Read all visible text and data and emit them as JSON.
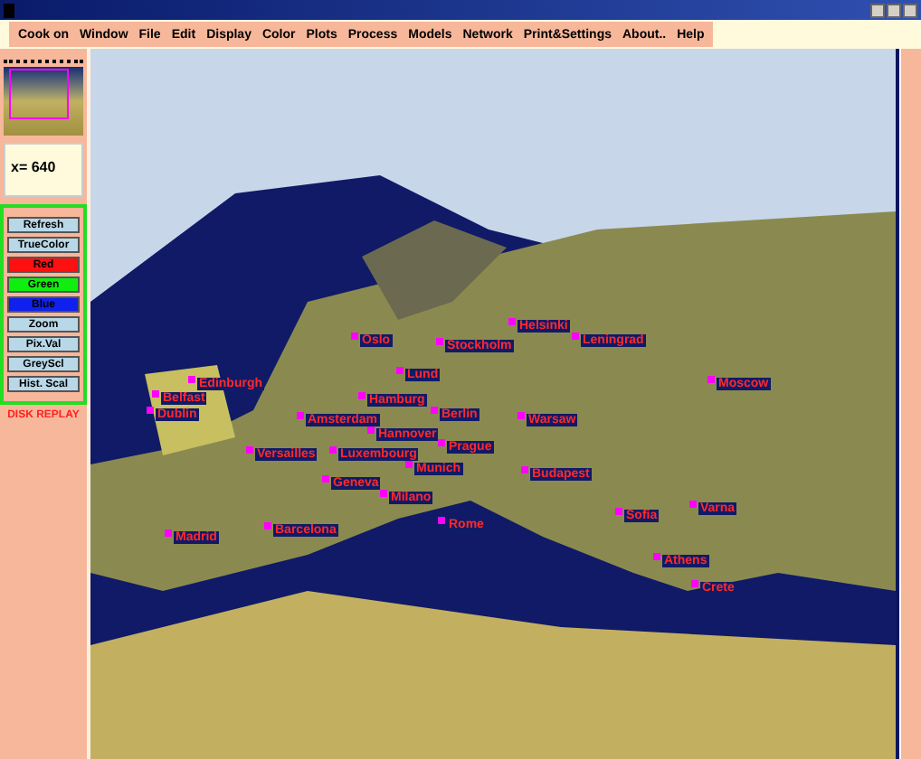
{
  "menu": [
    "Cook on",
    "Window",
    "File",
    "Edit",
    "Display",
    "Color",
    "Plots",
    "Process",
    "Models",
    "Network",
    "Print&Settings",
    "About..",
    "Help"
  ],
  "coordinate": "x= 640",
  "buttons": [
    {
      "label": "Refresh",
      "kind": "plain"
    },
    {
      "label": "TrueColor",
      "kind": "plain"
    },
    {
      "label": "Red",
      "kind": "red"
    },
    {
      "label": "Green",
      "kind": "green"
    },
    {
      "label": "Blue",
      "kind": "blue"
    },
    {
      "label": "Zoom",
      "kind": "plain"
    },
    {
      "label": "Pix.Val",
      "kind": "plain"
    },
    {
      "label": "GreyScl",
      "kind": "plain"
    },
    {
      "label": "Hist. Scal",
      "kind": "plain"
    }
  ],
  "status": "DISK REPLAY",
  "cities": [
    {
      "name": "Helsinki"
    },
    {
      "name": "Oslo"
    },
    {
      "name": "Stockholm"
    },
    {
      "name": "Leningrad"
    },
    {
      "name": "Lund"
    },
    {
      "name": "Edinburgh"
    },
    {
      "name": "Moscow"
    },
    {
      "name": "Belfast"
    },
    {
      "name": "Hamburg"
    },
    {
      "name": "Dublin"
    },
    {
      "name": "Amsterdam"
    },
    {
      "name": "Berlin"
    },
    {
      "name": "Warsaw"
    },
    {
      "name": "Hannover"
    },
    {
      "name": "Prague"
    },
    {
      "name": "Versailles"
    },
    {
      "name": "Luxembourg"
    },
    {
      "name": "Munich"
    },
    {
      "name": "Budapest"
    },
    {
      "name": "Geneva"
    },
    {
      "name": "Milano"
    },
    {
      "name": "Varna"
    },
    {
      "name": "Sofia"
    },
    {
      "name": "Rome"
    },
    {
      "name": "Barcelona"
    },
    {
      "name": "Madrid"
    },
    {
      "name": "Athens"
    },
    {
      "name": "Crete"
    }
  ]
}
